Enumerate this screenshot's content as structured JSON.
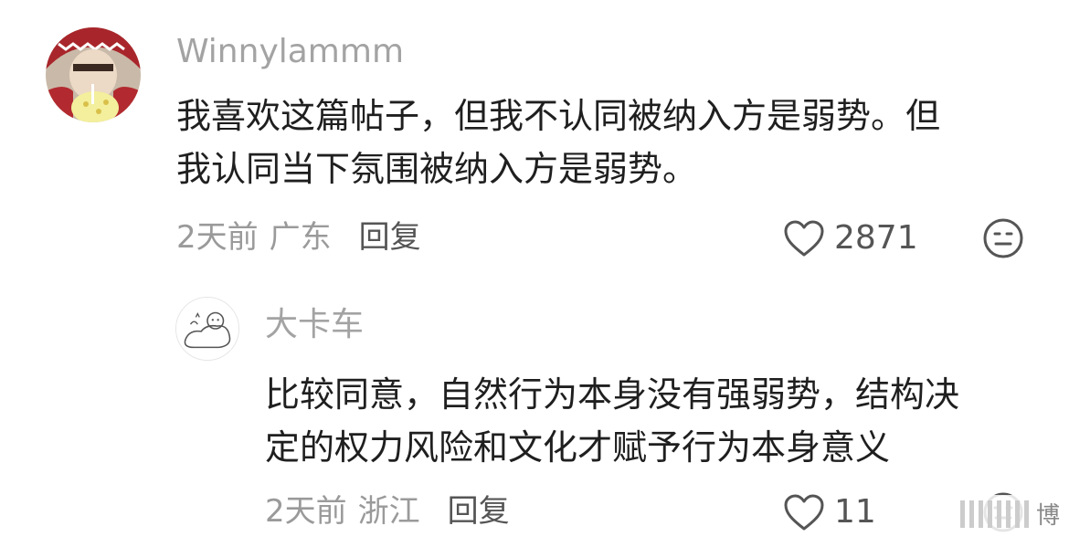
{
  "comments": [
    {
      "username": "Winnylammm",
      "text_line1": "我喜欢这篇帖子，但我不认同被纳入方是弱势。但",
      "text_line2": "我认同当下氛围被纳入方是弱势。",
      "time": "2天前",
      "location": "广东",
      "reply_label": "回复",
      "likes": "2871",
      "like_icon": "heart-outline-icon",
      "dislike_icon": "meh-face-icon"
    },
    {
      "username": "大卡车",
      "text_line1": "比较同意，自然行为本身没有强弱势，结构决",
      "text_line2": "定的权力风险和文化才赋予行为本身意义",
      "time": "2天前",
      "location": "浙江",
      "reply_label": "回复",
      "likes": "11",
      "like_icon": "heart-outline-icon",
      "dislike_icon": "meh-face-icon"
    }
  ],
  "watermark": {
    "text": "博"
  },
  "colors": {
    "username": "#a3a3a3",
    "meta": "#9a9a9a",
    "reply": "#555555",
    "body_text": "#1f1f1f"
  }
}
